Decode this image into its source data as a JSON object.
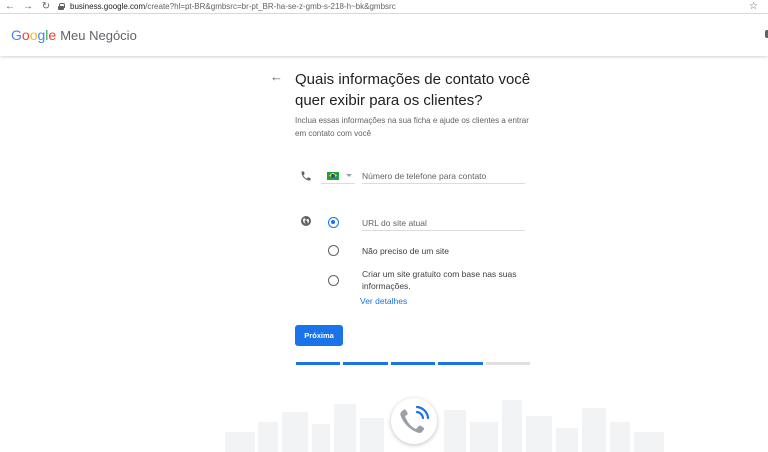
{
  "browser": {
    "back_icon": "arrow-left-icon",
    "forward_icon": "arrow-right-icon",
    "reload_icon": "reload-icon",
    "url_host": "business.google.com",
    "url_path": "/create?hl=pt-BR&gmbsrc=br-pt_BR-ha-se-z-gmb-s-218-h~bk&gmbsrc",
    "star_icon": "star-icon"
  },
  "header": {
    "logo_google": "Google",
    "logo_product": "Meu Negócio",
    "brand_colors": [
      "#4285f4",
      "#ea4335",
      "#fbbc05",
      "#4285f4",
      "#34a853",
      "#ea4335"
    ]
  },
  "main": {
    "title": "Quais informações de contato você quer exibir para os clientes?",
    "subtitle": "Inclua essas informações na sua ficha e ajude os clientes a entrar em contato com você",
    "phone": {
      "icon": "phone-icon",
      "country_flag": "brazil-flag-icon",
      "placeholder": "Número de telefone para contato",
      "value": ""
    },
    "website": {
      "icon": "globe-icon",
      "url_placeholder": "URL do site atual",
      "options": [
        {
          "label": "URL do site atual",
          "selected": true
        },
        {
          "label": "Não preciso de um site",
          "selected": false
        },
        {
          "label": "Criar um site gratuito com base nas suas informações.",
          "selected": false
        }
      ],
      "details_link": "Ver detalhes"
    },
    "next_button": "Próxima",
    "progress": {
      "total_steps": 5,
      "completed_steps": 4
    }
  },
  "colors": {
    "accent": "#1a73e8",
    "text": "#202124",
    "secondary_text": "#5f6368"
  }
}
